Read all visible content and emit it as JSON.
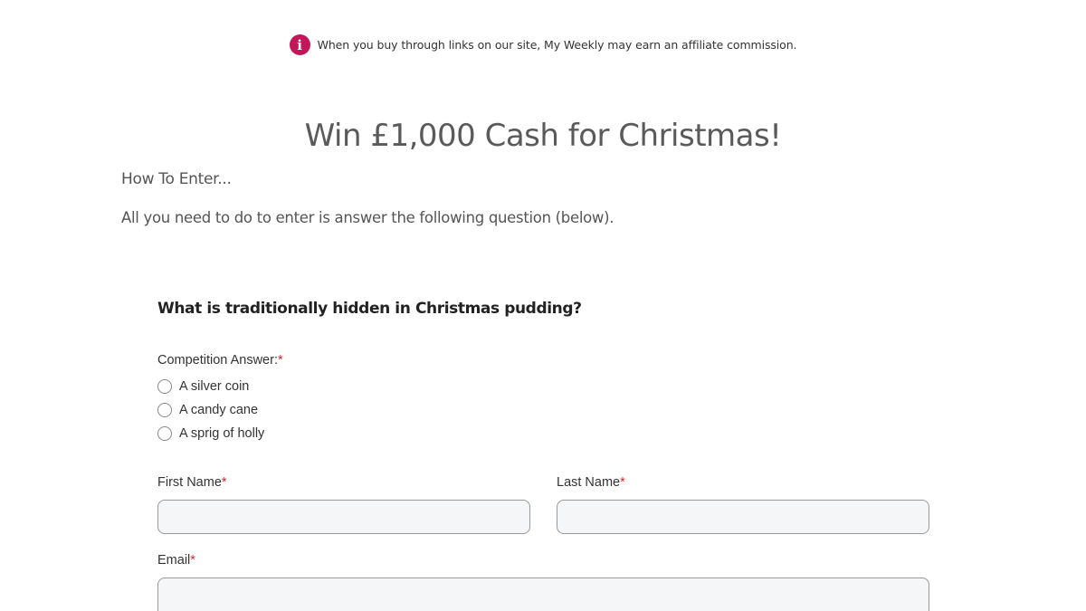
{
  "notice": {
    "icon": "info-icon",
    "icon_glyph": "i",
    "icon_color": "#c2185b",
    "text": "When you buy through links on our site, My Weekly may earn an affiliate commission."
  },
  "page": {
    "title": "Win £1,000 Cash for Christmas!",
    "how_to_enter": "How To Enter...",
    "intro": "All you need to do to enter is answer the following question (below)."
  },
  "form": {
    "question": "What is traditionally hidden in Christmas pudding?",
    "answer_label": "Competition Answer:",
    "required_marker": "*",
    "options": [
      {
        "label": "A silver coin"
      },
      {
        "label": "A candy cane"
      },
      {
        "label": "A sprig of holly"
      }
    ],
    "first_name_label": "First Name",
    "first_name_value": "",
    "last_name_label": "Last Name",
    "last_name_value": "",
    "email_label": "Email",
    "email_value": "",
    "required_color": "#d9272e"
  }
}
